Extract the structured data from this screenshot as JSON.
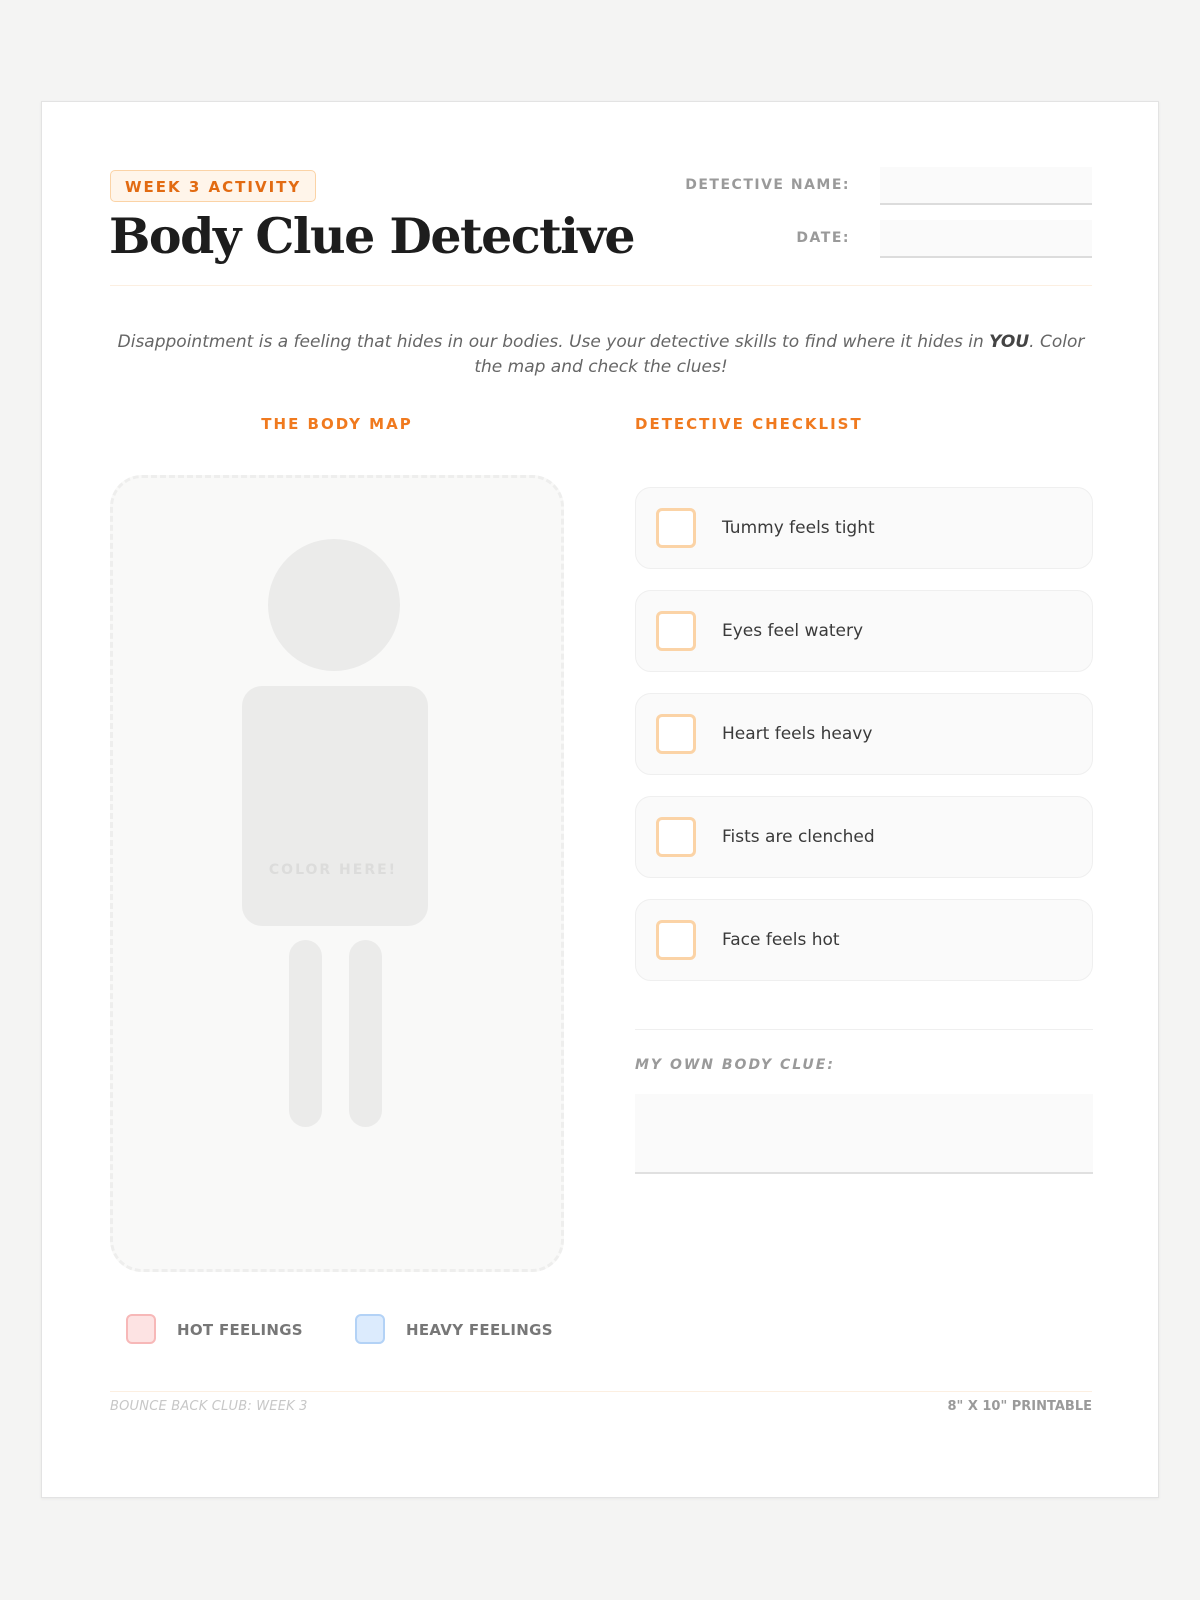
{
  "header": {
    "badge": "WEEK 3 ACTIVITY",
    "title": "Body Clue Detective",
    "name_label": "DETECTIVE NAME:",
    "date_label": "DATE:",
    "name_value": "",
    "date_value": ""
  },
  "intro": {
    "before": "Disappointment is a feeling that hides in our bodies. Use your detective skills to find where it hides in ",
    "emphasis": "YOU",
    "after": ". Color the map and check the clues!"
  },
  "body_map": {
    "title": "THE BODY MAP",
    "center_label": "COLOR HERE!",
    "legend": [
      {
        "label": "HOT FEELINGS",
        "fill": "#fde3e3",
        "border": "#f7b8b8"
      },
      {
        "label": "HEAVY FEELINGS",
        "fill": "#dcebfd",
        "border": "#b3d2f6"
      }
    ]
  },
  "checklist": {
    "title": "DETECTIVE CHECKLIST",
    "items": [
      {
        "label": "Tummy feels tight",
        "checked": false
      },
      {
        "label": "Eyes feel watery",
        "checked": false
      },
      {
        "label": "Heart feels heavy",
        "checked": false
      },
      {
        "label": "Fists are clenched",
        "checked": false
      },
      {
        "label": "Face feels hot",
        "checked": false
      }
    ]
  },
  "own_clue": {
    "label": "MY OWN BODY CLUE:",
    "value": ""
  },
  "footer": {
    "left": "BOUNCE BACK CLUB: WEEK 3",
    "right": "8\" X 10\" PRINTABLE"
  },
  "colors": {
    "accent": "#f07a1f",
    "badge_text": "#e26b12",
    "checkbox_border": "#fbd3a6"
  }
}
